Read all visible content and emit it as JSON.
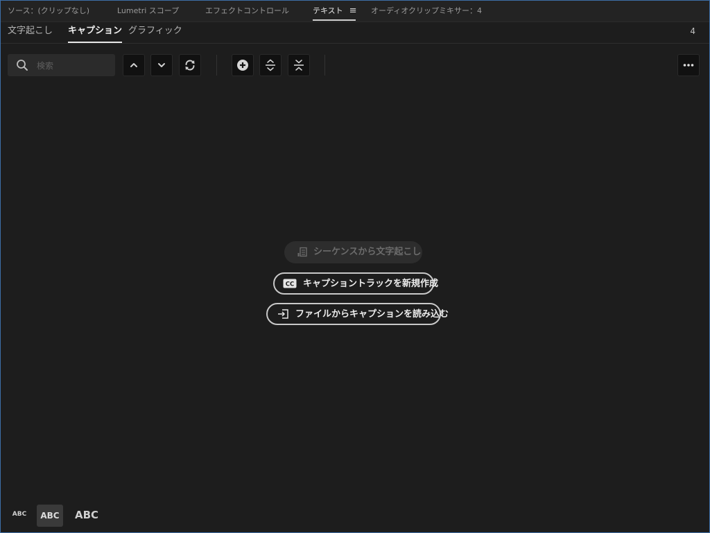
{
  "panel_tabs": {
    "source": "ソース：(クリップなし)",
    "lumetri": "Lumetri スコープ",
    "effect_controls": "エフェクトコントロール",
    "text": "テキスト",
    "audio_mixer": "オーディオクリップミキサー：4"
  },
  "sub_tabs": {
    "transcript": "文字起こし",
    "captions": "キャプション",
    "graphics": "グラフィック",
    "count": "4"
  },
  "search": {
    "placeholder": "検索",
    "value": ""
  },
  "toolbar": {
    "icons": [
      "chevron-up-icon",
      "chevron-down-icon",
      "refresh-icon",
      "add-circle-icon",
      "split-icon",
      "merge-icon",
      "more-icon"
    ]
  },
  "actions": {
    "transcribe": "シーケンスから文字起こし",
    "create_track": "キャプショントラックを新規作成",
    "import_file": "ファイルからキャプションを読み込む"
  },
  "text_size": {
    "small": "ABC",
    "medium": "ABC",
    "large": "ABC"
  },
  "colors": {
    "background": "#1d1d1d",
    "border_accent": "#3d6fa8",
    "button_bg": "#111111"
  }
}
